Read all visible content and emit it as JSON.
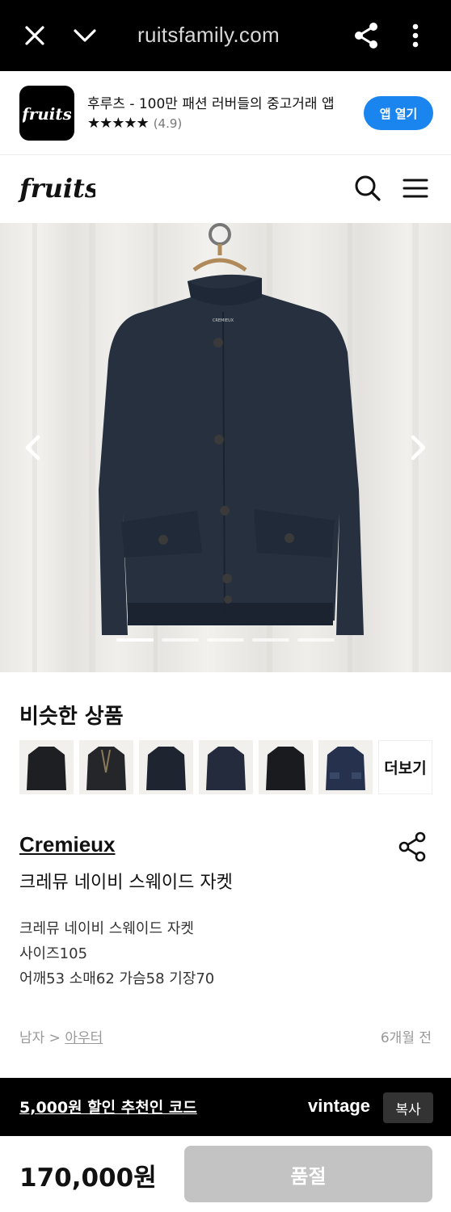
{
  "browser": {
    "url": "ruitsfamily.com",
    "close_icon": "close-icon",
    "chevron_icon": "chevron-down-icon",
    "share_icon": "share-icon",
    "more_icon": "more-vertical-icon"
  },
  "app_banner": {
    "logo_text": "fruits",
    "title": "후루츠 - 100만 패션 러버들의 중고거래 앱",
    "stars": "★★★★★",
    "rating": "(4.9)",
    "open_label": "앱 열기",
    "accent_color": "#1a84ef"
  },
  "header": {
    "logo_text": "fruits",
    "search_icon": "search-icon",
    "menu_icon": "hamburger-menu-icon"
  },
  "product_image": {
    "brand_label": "CREMIEUX",
    "prev_icon": "chevron-left-icon",
    "next_icon": "chevron-right-icon",
    "slide_count": 5,
    "active_slide": 1
  },
  "similar": {
    "title": "비슷한 상품",
    "more_label": "더보기",
    "items": [
      "jacket-1",
      "jacket-2",
      "jacket-3",
      "jacket-4",
      "jacket-5",
      "jacket-6"
    ]
  },
  "product": {
    "brand": "Cremieux",
    "name": "크레뮤 네이비 스웨이드 자켓",
    "desc_lines": [
      "크레뮤 네이비 스웨이드 자켓",
      "사이즈105",
      "어깨53 소매62 가슴58 기장70"
    ],
    "category_prefix": "남자 > ",
    "category_link": "아우터",
    "posted": "6개월 전"
  },
  "promo": {
    "text": "5,000원 할인 추천인 코드",
    "code": "vintage",
    "copy_label": "복사"
  },
  "purchase": {
    "price": "170,000원",
    "status_label": "품절"
  }
}
